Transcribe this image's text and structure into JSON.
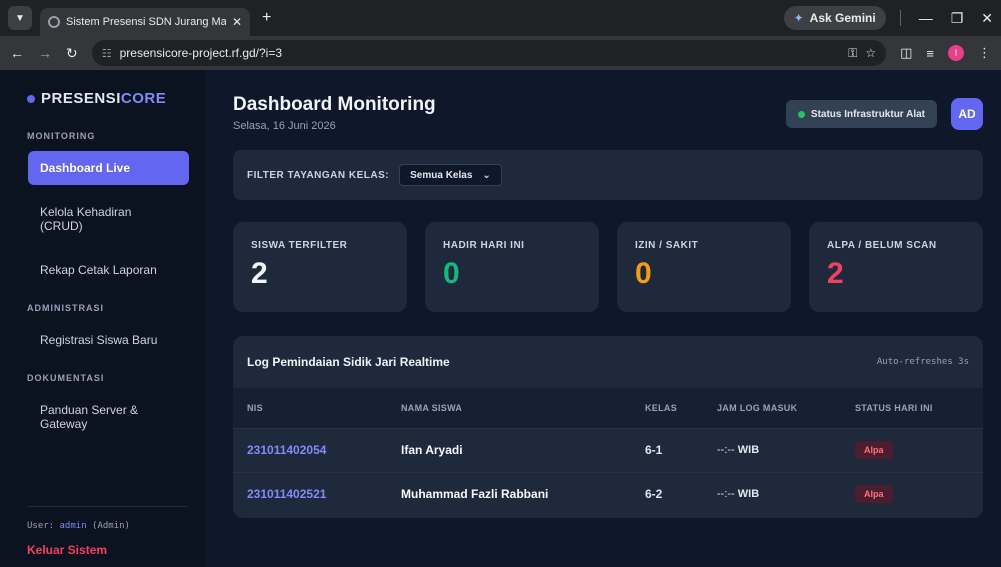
{
  "browser": {
    "tab_title": "Sistem Presensi SDN Jurang Ma",
    "url": "presensicore-project.rf.gd/?i=3",
    "gemini_label": "Ask Gemini",
    "profile_initial": "I"
  },
  "brand": {
    "prefix": "PRESENSI",
    "accent": "CORE"
  },
  "sidebar": {
    "sections": [
      {
        "label": "MONITORING"
      },
      {
        "label": "ADMINISTRASI"
      },
      {
        "label": "DOKUMENTASI"
      }
    ],
    "items": [
      {
        "label": "Dashboard Live"
      },
      {
        "label": "Kelola Kehadiran (CRUD)"
      },
      {
        "label": "Rekap Cetak Laporan"
      },
      {
        "label": "Registrasi Siswa Baru"
      },
      {
        "label": "Panduan Server & Gateway"
      }
    ],
    "user_prefix": "User:",
    "user_name": "admin",
    "user_role": "(Admin)",
    "logout": "Keluar Sistem"
  },
  "header": {
    "title": "Dashboard Monitoring",
    "date": "Selasa, 16 Juni 2026",
    "status_button": "Status Infrastruktur Alat",
    "avatar": "AD"
  },
  "filter": {
    "label": "FILTER TAYANGAN KELAS:",
    "selected": "Semua Kelas"
  },
  "stats": [
    {
      "label": "SISWA TERFILTER",
      "value": "2",
      "color": "#f1f5f9"
    },
    {
      "label": "HADIR HARI INI",
      "value": "0",
      "color": "#10b981"
    },
    {
      "label": "IZIN / SAKIT",
      "value": "0",
      "color": "#f59e0b"
    },
    {
      "label": "ALPA / BELUM SCAN",
      "value": "2",
      "color": "#f43f5e"
    }
  ],
  "log": {
    "title": "Log Pemindaian Sidik Jari Realtime",
    "auto_refresh": "Auto-refreshes 3s",
    "columns": [
      "NIS",
      "NAMA SISWA",
      "KELAS",
      "JAM LOG MASUK",
      "STATUS HARI INI"
    ],
    "rows": [
      {
        "nis": "231011402054",
        "nama": "Ifan Aryadi",
        "kelas": "6-1",
        "jam": "--:--",
        "wib": "WIB",
        "status": "Alpa"
      },
      {
        "nis": "231011402521",
        "nama": "Muhammad Fazli Rabbani",
        "kelas": "6-2",
        "jam": "--:--",
        "wib": "WIB",
        "status": "Alpa"
      }
    ]
  }
}
